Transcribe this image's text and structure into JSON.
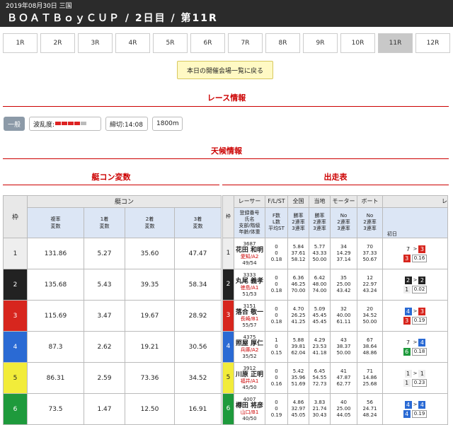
{
  "header": {
    "date": "2019年08月30日 三国",
    "title": "ＢＯＡＴＢｏｙＣＵＰ / 2日目 / 第11R"
  },
  "tabs": [
    "1R",
    "2R",
    "3R",
    "4R",
    "5R",
    "6R",
    "7R",
    "8R",
    "9R",
    "10R",
    "11R",
    "12R"
  ],
  "active_tab": "11R",
  "back_button": "本日の開催会場一覧に戻る",
  "race_info": {
    "heading": "レース情報",
    "grade": "一般",
    "wave_label": "波乱度:",
    "deadline": "締切:14:08",
    "distance": "1800m",
    "wave_level": 4
  },
  "weather": {
    "heading": "天候情報"
  },
  "left": {
    "heading": "艇コン変数",
    "col_frame": "枠",
    "col_group": "艇コン",
    "cols": [
      "複率\n変数",
      "1着\n変数",
      "2着\n変数",
      "3着\n変数"
    ],
    "rows": [
      {
        "frame": "1",
        "v": [
          "131.86",
          "5.27",
          "35.60",
          "47.47"
        ]
      },
      {
        "frame": "2",
        "v": [
          "135.68",
          "5.43",
          "39.35",
          "58.34"
        ]
      },
      {
        "frame": "3",
        "v": [
          "115.69",
          "3.47",
          "19.67",
          "28.92"
        ]
      },
      {
        "frame": "4",
        "v": [
          "87.3",
          "2.62",
          "19.21",
          "30.56"
        ]
      },
      {
        "frame": "5",
        "v": [
          "86.31",
          "2.59",
          "73.36",
          "34.52"
        ]
      },
      {
        "frame": "6",
        "v": [
          "73.5",
          "1.47",
          "12.50",
          "16.91"
        ]
      }
    ]
  },
  "right": {
    "heading": "出走表",
    "cols": [
      "枠",
      "レーサー",
      "F/L/ST",
      "全国",
      "当地",
      "モーター",
      "ボート",
      "レ"
    ],
    "subcols": [
      "登録番号\n氏名\n支部/階級\n年齢/体重",
      "F数\nL数\n平均ST",
      "勝率\n2連率\n3連率",
      "勝率\n2連率\n3連率",
      "No\n2連率\n3連率",
      "No\n2連率\n3連率",
      "初日"
    ],
    "rows": [
      {
        "frame": "1",
        "reg": "3687",
        "name": "花田 和明",
        "branch": "愛知/A2",
        "age": "49/54",
        "fl": [
          "0",
          "0",
          "0.18"
        ],
        "nat": [
          "5.84",
          "37.61",
          "58.12"
        ],
        "loc": [
          "5.77",
          "43.33",
          "50.00"
        ],
        "motor": [
          "34",
          "14.29",
          "37.14"
        ],
        "boat": [
          "70",
          "37.33",
          "50.67"
        ],
        "r1": "7",
        "r2": "3",
        "r3": "3",
        "r4": "0.16"
      },
      {
        "frame": "2",
        "reg": "3333",
        "name": "丸尾 義孝",
        "branch": "徳島/A1",
        "age": "51/53",
        "fl": [
          "0",
          "0",
          "0.18"
        ],
        "nat": [
          "6.36",
          "46.25",
          "70.00"
        ],
        "loc": [
          "6.42",
          "48.00",
          "74.00"
        ],
        "motor": [
          "35",
          "25.00",
          "43.42"
        ],
        "boat": [
          "12",
          "22.97",
          "43.24"
        ],
        "r1": "2",
        "r2": "2",
        "r3": "1",
        "r4": "0.02"
      },
      {
        "frame": "3",
        "reg": "3151",
        "name": "落合 敬一",
        "branch": "長崎/B1",
        "age": "55/57",
        "fl": [
          "0",
          "0",
          "0.18"
        ],
        "nat": [
          "4.70",
          "26.25",
          "41.25"
        ],
        "loc": [
          "5.09",
          "45.45",
          "45.45"
        ],
        "motor": [
          "32",
          "40.00",
          "61.11"
        ],
        "boat": [
          "20",
          "34.52",
          "50.00"
        ],
        "r1": "4",
        "r2": "3",
        "r3": "3",
        "r4": "0.19"
      },
      {
        "frame": "4",
        "reg": "4375",
        "name": "照屋 厚仁",
        "branch": "兵庫/A2",
        "age": "35/52",
        "fl": [
          "1",
          "0",
          "0.15"
        ],
        "nat": [
          "5.88",
          "39.81",
          "62.04"
        ],
        "loc": [
          "4.29",
          "23.53",
          "41.18"
        ],
        "motor": [
          "43",
          "38.37",
          "50.00"
        ],
        "boat": [
          "67",
          "38.64",
          "48.86"
        ],
        "r1": "7",
        "r2": "4",
        "r3": "6",
        "r4": "0.18"
      },
      {
        "frame": "5",
        "reg": "3912",
        "name": "川原 正明",
        "branch": "福井/A1",
        "age": "45/50",
        "fl": [
          "0",
          "0",
          "0.16"
        ],
        "nat": [
          "5.42",
          "35.96",
          "51.69"
        ],
        "loc": [
          "6.45",
          "54.55",
          "72.73"
        ],
        "motor": [
          "41",
          "47.87",
          "62.77"
        ],
        "boat": [
          "71",
          "14.86",
          "25.68"
        ],
        "r1": "1",
        "r2": "1",
        "r3": "1",
        "r4": "0.23"
      },
      {
        "frame": "6",
        "reg": "4007",
        "name": "樽田 将彦",
        "branch": "山口/B1",
        "age": "40/50",
        "fl": [
          "0",
          "0",
          "0.19"
        ],
        "nat": [
          "4.86",
          "32.97",
          "45.05"
        ],
        "loc": [
          "3.83",
          "21.74",
          "30.43"
        ],
        "motor": [
          "40",
          "25.00",
          "44.05"
        ],
        "boat": [
          "56",
          "24.71",
          "48.24"
        ],
        "r1": "4",
        "r2": "4",
        "r3": "4",
        "r4": "0.19"
      }
    ]
  },
  "colors": {
    "frame1": "#eeeeee",
    "frame2": "#222222",
    "frame3": "#d7261e",
    "frame4": "#2a6ad4",
    "frame5": "#f2ec3a",
    "frame6": "#1e9a3c",
    "accent": "#cc0000"
  }
}
